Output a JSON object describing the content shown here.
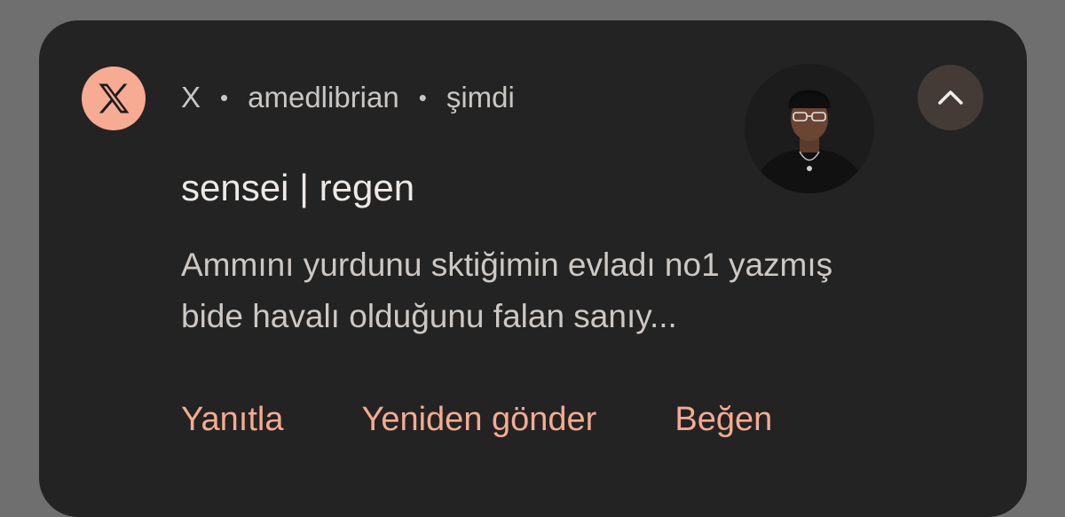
{
  "notification": {
    "app_icon": "x-logo-icon",
    "app_name": "X",
    "username": "amedlibrian",
    "time": "şimdi",
    "separator": "•",
    "title": "sensei | regen",
    "message_line1": "Ammını yurdunu sktiğimin evladı no1 yazmış",
    "message_line2": "bide havalı olduğunu falan sanıy...",
    "collapse_icon": "chevron-up-icon",
    "actions": [
      {
        "label": "Yanıtla"
      },
      {
        "label": "Yeniden gönder"
      },
      {
        "label": "Beğen"
      }
    ]
  },
  "colors": {
    "card_bg": "#232323",
    "page_bg": "#6f6f6f",
    "accent": "#f4ab91",
    "app_icon_bg": "#f6ab92",
    "collapse_bg": "#453b36"
  }
}
